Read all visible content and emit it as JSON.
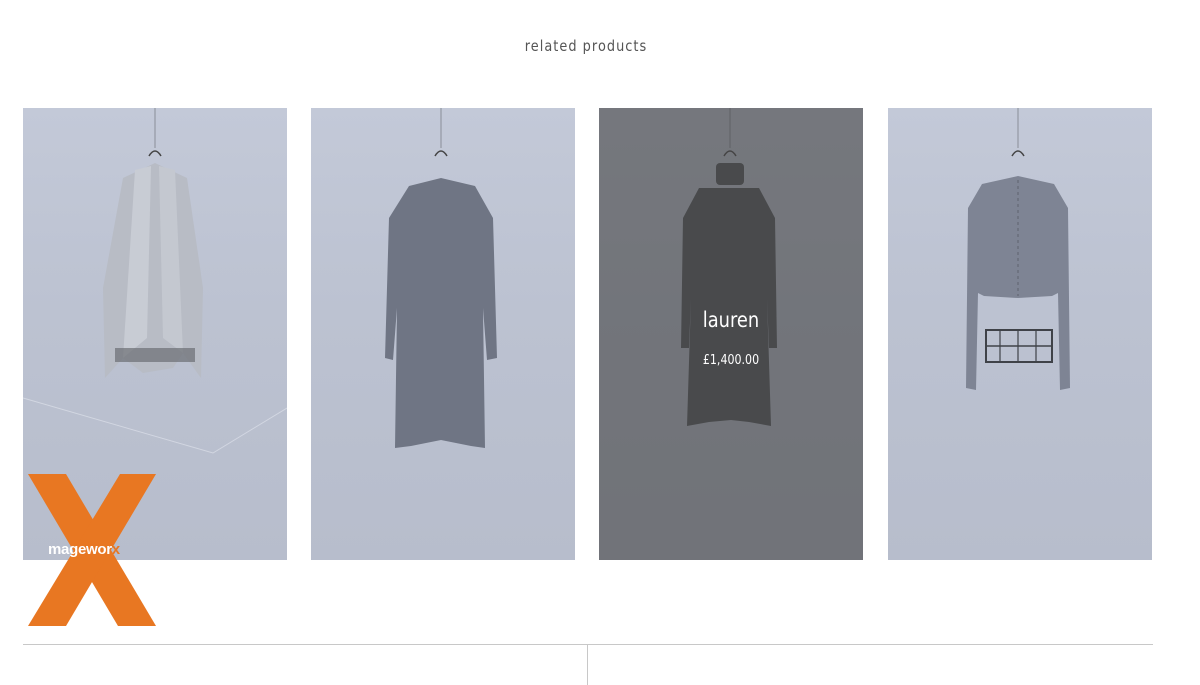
{
  "section": {
    "title": "related products"
  },
  "products": [
    {
      "name": "",
      "price": "",
      "image": "grey wrap cardigan on hanger",
      "hovered": false
    },
    {
      "name": "",
      "price": "",
      "image": "grey long knit dress on hanger",
      "hovered": false
    },
    {
      "name": "lauren",
      "price": "£1,400.00",
      "image": "turtleneck knit dress on hanger",
      "hovered": true
    },
    {
      "name": "",
      "price": "",
      "image": "cropped grey knit top with metal rack",
      "hovered": false
    }
  ],
  "logo": {
    "text_main": "magewor",
    "text_accent": "x",
    "accent_color": "#e87722"
  },
  "colors": {
    "background": "#ffffff",
    "overlay": "#5a5a5a",
    "divider": "#c8c8c8"
  }
}
